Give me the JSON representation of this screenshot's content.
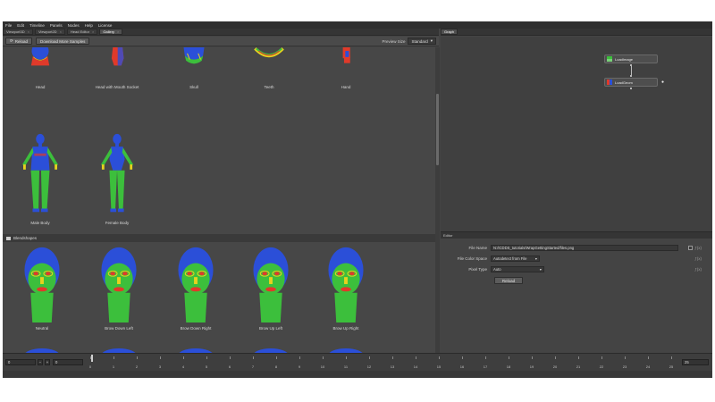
{
  "menu": [
    "File",
    "Edit",
    "Timeline",
    "Panels",
    "Nodes",
    "Help",
    "License"
  ],
  "left_tabs": [
    {
      "label": "Viewport3D",
      "active": false
    },
    {
      "label": "Viewport2D",
      "active": false
    },
    {
      "label": "Head Editor",
      "active": false
    },
    {
      "label": "Gallery",
      "active": true
    }
  ],
  "right_tabs": [
    {
      "label": "Graph"
    }
  ],
  "toolbar": {
    "reload_label": "Reload",
    "download_label": "Download More Samples",
    "preview_size_label": "Preview Size",
    "preview_size_value": "Standard"
  },
  "gallery": {
    "top_row": [
      "Head",
      "Head with Mouth Socket",
      "Skull",
      "Teeth",
      "Hand"
    ],
    "bodies": [
      "Male Body",
      "Female Body"
    ],
    "blendshapes_header": "Blendshapes",
    "blendshapes": [
      "Neutral",
      "Brow Down Left",
      "Brow Down Right",
      "Brow Up Left",
      "Brow Up Right"
    ]
  },
  "graph": {
    "nodes": [
      "LoadImage",
      "LoadGeom"
    ]
  },
  "editor": {
    "tab_label": "Editor",
    "file_name_label": "File Name",
    "file_name_value": "N:/ICDDS_tutorials/WrapGettingStarted/files.png",
    "color_space_label": "File Color Space",
    "color_space_value": "Autodetect from File",
    "pixel_type_label": "Pixel Type",
    "pixel_type_value": "Auto",
    "reload_label": "Reload",
    "fx": "ƒ(x)"
  },
  "timeline": {
    "start_value": "0",
    "current_value": "0",
    "end_value": "25",
    "ticks": [
      "0",
      "1",
      "2",
      "3",
      "4",
      "5",
      "6",
      "7",
      "8",
      "9",
      "10",
      "11",
      "12",
      "13",
      "14",
      "15",
      "16",
      "17",
      "18",
      "19",
      "20",
      "21",
      "22",
      "23",
      "24",
      "25"
    ]
  },
  "colors": {
    "mesh_blue": "#2b4fd8",
    "mesh_green": "#3cbf3c",
    "mesh_yellow": "#e6d21e",
    "mesh_red": "#e03a2a"
  }
}
